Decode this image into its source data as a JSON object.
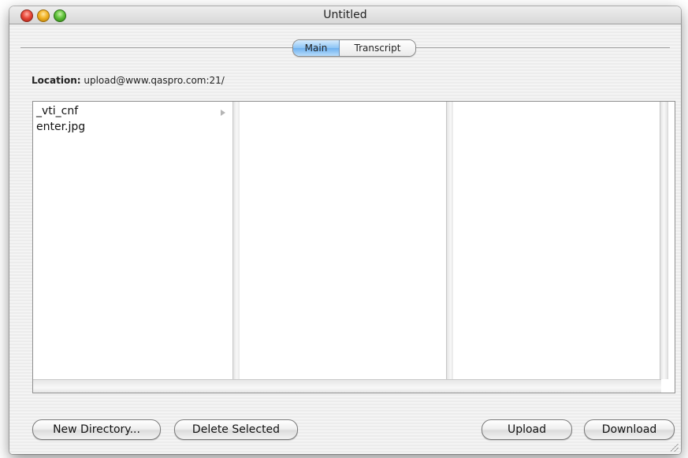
{
  "window": {
    "title": "Untitled"
  },
  "tabs": {
    "main": "Main",
    "transcript": "Transcript"
  },
  "location": {
    "label": "Location:",
    "value": "upload@www.qaspro.com:21/"
  },
  "browser": {
    "column1": [
      {
        "name": "_vti_cnf",
        "type": "folder"
      },
      {
        "name": "enter.jpg",
        "type": "file"
      }
    ]
  },
  "buttons": {
    "new_directory": "New Directory...",
    "delete_selected": "Delete Selected",
    "upload": "Upload",
    "download": "Download"
  },
  "icons": {
    "close": "close-icon",
    "minimize": "minimize-icon",
    "zoom": "zoom-icon",
    "disclosure": "chevron-right-icon",
    "resize": "resize-grip-icon"
  }
}
